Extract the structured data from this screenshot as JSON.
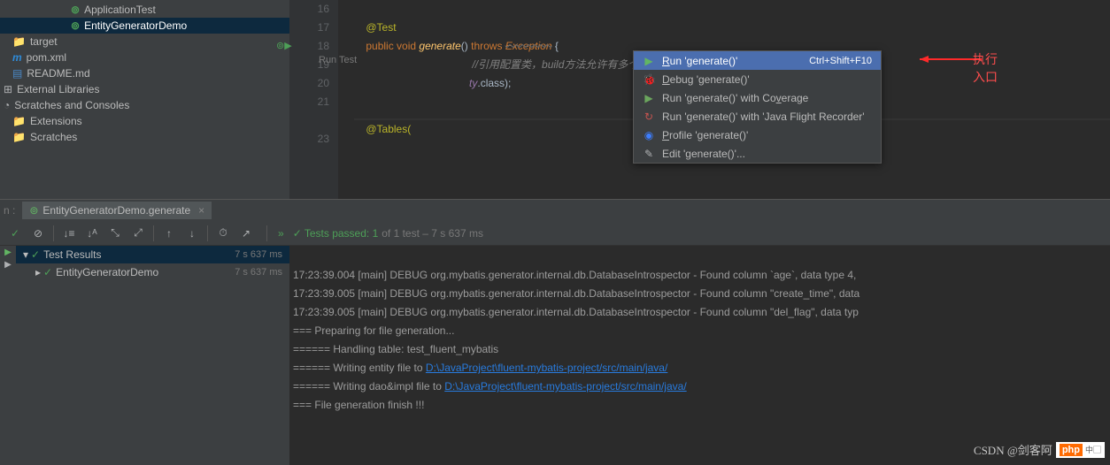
{
  "project_tree": {
    "items": [
      {
        "label": "ApplicationTest",
        "icon": "test",
        "indent": 1,
        "selected": false
      },
      {
        "label": "EntityGeneratorDemo",
        "icon": "test",
        "indent": 1,
        "selected": true
      },
      {
        "label": "target",
        "icon": "folder",
        "indent": 0,
        "selected": false
      },
      {
        "label": "pom.xml",
        "icon": "maven",
        "indent": 0,
        "selected": false
      },
      {
        "label": "README.md",
        "icon": "md",
        "indent": 0,
        "selected": false
      },
      {
        "label": "External Libraries",
        "icon": "lib",
        "indent": -1,
        "selected": false
      },
      {
        "label": "Scratches and Consoles",
        "icon": "scratch",
        "indent": -1,
        "selected": false
      },
      {
        "label": "Extensions",
        "icon": "folder-grey",
        "indent": 0,
        "selected": false
      },
      {
        "label": "Scratches",
        "icon": "folder-grey",
        "indent": 0,
        "selected": false
      }
    ]
  },
  "editor": {
    "line_numbers": [
      "16",
      "17",
      "18",
      "19",
      "20",
      "21",
      "",
      "23"
    ],
    "lines": {
      "l17": "@Test",
      "l18_kw1": "public",
      "l18_kw2": "void",
      "l18_fn": "generate",
      "l18_paren": "()",
      "l18_kw3": "throws",
      "l18_ex": "Exception",
      "l18_brace": " {",
      "l19_comment": "//引用配置类，build方法允许有多个配置类",
      "l19_vis": "ty",
      "l19_cls": ".class);",
      "l20_pre": "",
      "l21": "",
      "l23": "@Tables("
    }
  },
  "context_menu": {
    "title_hint": "Run Test",
    "items": [
      {
        "icon": "▶",
        "label_pre": "",
        "label_u": "R",
        "label_post": "un 'generate()'",
        "shortcut": "Ctrl+Shift+F10",
        "hl": true,
        "color": "#4d9f57"
      },
      {
        "icon": "🐞",
        "label_pre": "",
        "label_u": "D",
        "label_post": "ebug 'generate()'",
        "shortcut": "",
        "hl": false,
        "color": "#d6651a"
      },
      {
        "icon": "▶",
        "label_pre": "Run 'generate()' with Co",
        "label_u": "v",
        "label_post": "erage",
        "shortcut": "",
        "hl": false,
        "color": "#4d9f57"
      },
      {
        "icon": "↻",
        "label_pre": "Run 'generate()' with 'Java Flight Recorder'",
        "label_u": "",
        "label_post": "",
        "shortcut": "",
        "hl": false,
        "color": "#c75450"
      },
      {
        "icon": "◉",
        "label_pre": "",
        "label_u": "P",
        "label_post": "rofile 'generate()'",
        "shortcut": "",
        "hl": false,
        "color": "#3d7eff"
      },
      {
        "icon": "✎",
        "label_pre": "Edit 'generate()'...",
        "label_u": "",
        "label_post": "",
        "shortcut": "",
        "hl": false,
        "color": "#afb1b3"
      }
    ]
  },
  "annotation": {
    "text": "执行入口"
  },
  "run_panel": {
    "tab_prefix": "n :",
    "tab_label": "EntityGeneratorDemo.generate",
    "status_pass": "✓ Tests passed: 1",
    "status_rest": " of 1 test – 7 s 637 ms",
    "tree": [
      {
        "label": "Test Results",
        "time": "7 s 637 ms",
        "selected": true,
        "expand": "▾"
      },
      {
        "label": "EntityGeneratorDemo",
        "time": "7 s 637 ms",
        "selected": false,
        "expand": "▸"
      }
    ],
    "console": [
      "17:23:39.004 [main] DEBUG org.mybatis.generator.internal.db.DatabaseIntrospector - Found column `age`, data type 4, ",
      "17:23:39.005 [main] DEBUG org.mybatis.generator.internal.db.DatabaseIntrospector - Found column \"create_time\", data ",
      "17:23:39.005 [main] DEBUG org.mybatis.generator.internal.db.DatabaseIntrospector - Found column \"del_flag\", data typ",
      "=== Preparing for file generation...",
      "====== Handling table: test_fluent_mybatis",
      "====== Writing entity file to ",
      "====== Writing dao&impl file to ",
      "=== File generation finish !!!"
    ],
    "link1": "D:\\JavaProject\\fluent-mybatis-project/src/main/java/",
    "link2": "D:\\JavaProject\\fluent-mybatis-project/src/main/java/"
  },
  "watermark": {
    "csdn": "CSDN @剑客阿",
    "php": "php"
  }
}
